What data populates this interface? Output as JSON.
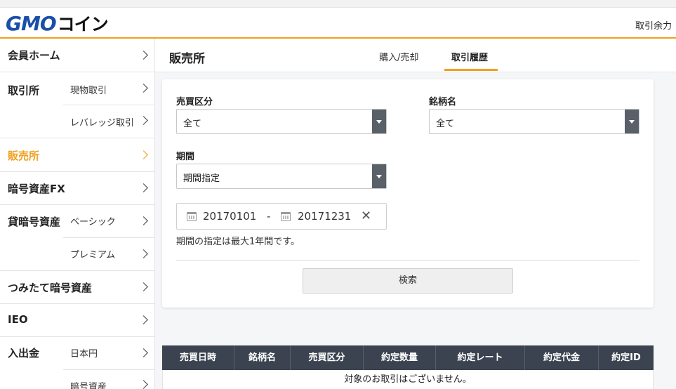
{
  "header": {
    "logo_gmo": "GMO",
    "logo_coin": "コイン",
    "right_link": "取引余力"
  },
  "sidebar": {
    "groups": [
      {
        "head": "会員ホーム",
        "subs": []
      },
      {
        "head": "取引所",
        "subs": [
          "現物取引",
          "レバレッジ取引"
        ]
      },
      {
        "head": "販売所",
        "subs": [],
        "active": true
      },
      {
        "head": "暗号資産FX",
        "subs": []
      },
      {
        "head": "貸暗号資産",
        "subs": [
          "ベーシック",
          "プレミアム"
        ]
      },
      {
        "head": "つみたて暗号資産",
        "subs": []
      },
      {
        "head": "IEO",
        "subs": []
      },
      {
        "head": "入出金",
        "subs": [
          "日本円",
          "暗号資産"
        ]
      }
    ]
  },
  "topnav": {
    "title": "販売所",
    "tabs": [
      {
        "label": "購入/売却",
        "active": false
      },
      {
        "label": "取引履歴",
        "active": true
      }
    ]
  },
  "form": {
    "trade_type_label": "売買区分",
    "trade_type_value": "全て",
    "symbol_label": "銘柄名",
    "symbol_value": "全て",
    "period_label": "期間",
    "period_value": "期間指定",
    "date_from": "20170101",
    "date_sep": "-",
    "date_to": "20171231",
    "clear": "✕",
    "note": "期間の指定は最大1年間です。",
    "search_label": "検索"
  },
  "table": {
    "columns": [
      "売買日時",
      "銘柄名",
      "売買区分",
      "約定数量",
      "約定レート",
      "約定代金",
      "約定ID"
    ],
    "empty_message": "対象のお取引はございません。"
  },
  "colors": {
    "accent": "#f0a020",
    "brand_blue": "#1a4fa8",
    "table_header": "#3b4350"
  }
}
